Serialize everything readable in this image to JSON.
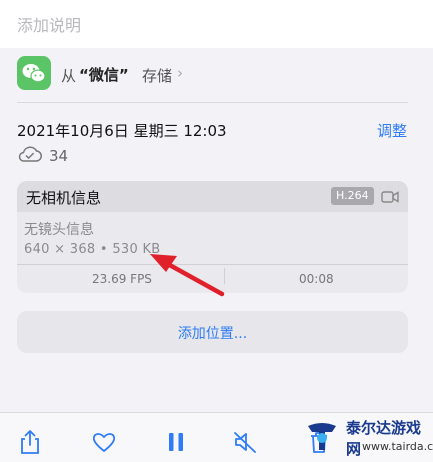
{
  "caption": {
    "placeholder": "添加说明"
  },
  "source": {
    "prefix": "从",
    "app": "“微信”",
    "suffix": "存储",
    "chevron": "›",
    "icon": "wechat-icon",
    "icon_color": "#5ac466"
  },
  "datetime": "2021年10月6日 星期三 12:03",
  "adjust_label": "调整",
  "cloud": {
    "icon": "cloud-check-icon",
    "count": "34"
  },
  "info_card": {
    "title": "无相机信息",
    "codec": "H.264",
    "lens": "无镜头信息",
    "specs": "640 × 368  •  530 KB",
    "fps": "23.69 FPS",
    "duration": "00:08"
  },
  "location_label": "添加位置...",
  "toolbar": {
    "icons": [
      "share-icon",
      "heart-icon",
      "pause-icon",
      "mute-icon",
      "trash-icon"
    ]
  },
  "watermark": {
    "name": "泰尔达游戏网",
    "url": "www.tairda.com"
  },
  "colors": {
    "accent": "#2f7cf6",
    "annotation": "#e0202a",
    "watermark": "#1a3a8f"
  }
}
